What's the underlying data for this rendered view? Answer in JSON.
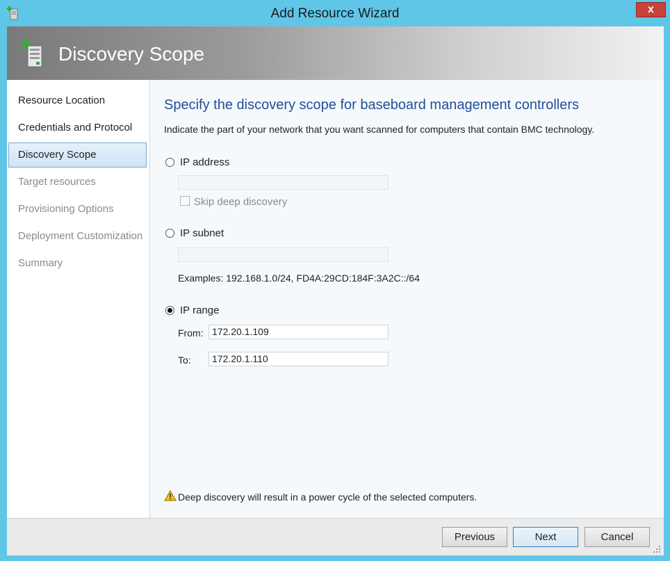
{
  "window": {
    "title": "Add Resource Wizard",
    "close_label": "x"
  },
  "header": {
    "title": "Discovery Scope"
  },
  "nav": {
    "items": [
      {
        "label": "Resource Location"
      },
      {
        "label": "Credentials and Protocol"
      },
      {
        "label": "Discovery Scope"
      },
      {
        "label": "Target resources"
      },
      {
        "label": "Provisioning Options"
      },
      {
        "label": "Deployment Customization"
      },
      {
        "label": "Summary"
      }
    ],
    "active_index": 2
  },
  "main": {
    "heading": "Specify the discovery scope for baseboard management controllers",
    "description": "Indicate the part of your network that you want scanned for computers that contain BMC technology.",
    "ip_address": {
      "label": "IP address",
      "value": "",
      "skip_label": "Skip deep discovery"
    },
    "ip_subnet": {
      "label": "IP subnet",
      "value": "",
      "examples": "Examples: 192.168.1.0/24, FD4A:29CD:184F:3A2C::/64"
    },
    "ip_range": {
      "label": "IP range",
      "from_label": "From:",
      "from_value": "172.20.1.109",
      "to_label": "To:",
      "to_value": "172.20.1.110"
    },
    "selected_option": "ip_range",
    "warning": "Deep discovery will result in a power cycle of the selected computers."
  },
  "footer": {
    "previous": "Previous",
    "next": "Next",
    "cancel": "Cancel"
  },
  "colors": {
    "titlebar": "#5fc6e8",
    "heading": "#1f4e9c",
    "close": "#c8413a"
  }
}
